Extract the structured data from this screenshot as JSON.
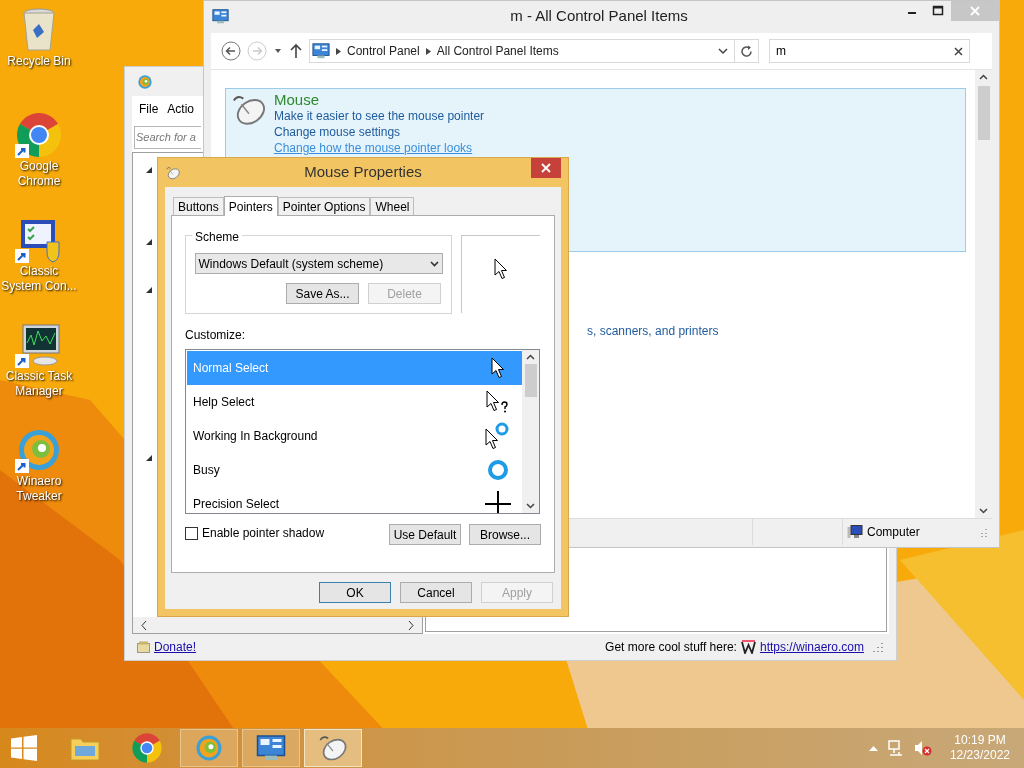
{
  "desktop_icons": [
    {
      "label": "Recycle Bin",
      "kind": "recycle-bin"
    },
    {
      "label": "Google Chrome",
      "kind": "chrome"
    },
    {
      "label": "Classic System Con...",
      "kind": "system-config"
    },
    {
      "label": "Classic Task Manager",
      "kind": "task-manager"
    },
    {
      "label": "Winaero Tweaker",
      "kind": "winaero"
    }
  ],
  "winaero_window": {
    "menu": [
      "File",
      "Actio"
    ],
    "search_placeholder": "Search for a",
    "donate": "Donate!",
    "promo": "Get more cool stuff here:",
    "site_link": "https://winaero.com"
  },
  "control_panel": {
    "title": "m - All Control Panel Items",
    "breadcrumb": [
      "Control Panel",
      "All Control Panel Items"
    ],
    "search": "m",
    "item": {
      "name": "Mouse",
      "selected": true,
      "links": [
        {
          "label": "Make it easier to see the mouse pointer",
          "hovered": false
        },
        {
          "label": "Change mouse settings",
          "hovered": false
        },
        {
          "label": "Change how the mouse pointer looks",
          "hovered": true
        }
      ]
    },
    "partial_link": "s, scanners, and printers",
    "status": "Computer"
  },
  "mouse_properties": {
    "title": "Mouse Properties",
    "tabs": [
      {
        "label": "Buttons",
        "selected": false
      },
      {
        "label": "Pointers",
        "selected": true
      },
      {
        "label": "Pointer Options",
        "selected": false
      },
      {
        "label": "Wheel",
        "selected": false
      }
    ],
    "scheme_label": "Scheme",
    "scheme_value": "Windows Default (system scheme)",
    "scheme_buttons": [
      {
        "label": "Save As...",
        "disabled": false
      },
      {
        "label": "Delete",
        "disabled": true
      }
    ],
    "customize_label": "Customize:",
    "pointers": [
      {
        "name": "Normal Select",
        "kind": "arrow",
        "selected": true
      },
      {
        "name": "Help Select",
        "kind": "help",
        "selected": false
      },
      {
        "name": "Working In Background",
        "kind": "working",
        "selected": false
      },
      {
        "name": "Busy",
        "kind": "busy",
        "selected": false
      },
      {
        "name": "Precision Select",
        "kind": "cross",
        "selected": false
      }
    ],
    "shadow": {
      "label": "Enable pointer shadow",
      "checked": false
    },
    "list_buttons": [
      {
        "label": "Use Default",
        "disabled": false
      },
      {
        "label": "Browse...",
        "disabled": false
      }
    ],
    "footer_buttons": [
      {
        "label": "OK",
        "default": true,
        "disabled": false
      },
      {
        "label": "Cancel",
        "default": false,
        "disabled": false
      },
      {
        "label": "Apply",
        "default": false,
        "disabled": true
      }
    ]
  },
  "taskbar": {
    "apps": [
      {
        "kind": "explorer",
        "open": false,
        "active": false
      },
      {
        "kind": "chrome",
        "open": false,
        "active": false
      },
      {
        "kind": "winaero",
        "open": true,
        "active": false
      },
      {
        "kind": "control-panel",
        "open": true,
        "active": false
      },
      {
        "kind": "mouse",
        "open": true,
        "active": true
      }
    ],
    "volume_muted": true,
    "time": "10:19 PM",
    "date": "12/23/2022"
  }
}
